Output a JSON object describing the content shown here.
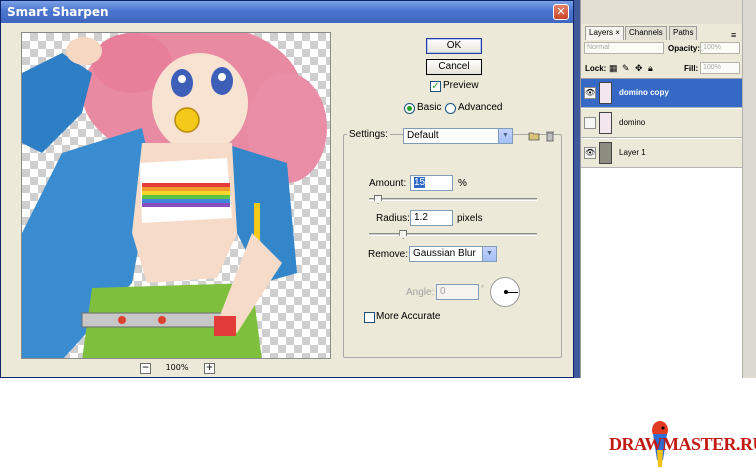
{
  "dialog": {
    "title": "Smart Sharpen",
    "close_glyph": "✕",
    "ok_label": "OK",
    "cancel_label": "Cancel",
    "preview_label": "Preview",
    "preview_checked": true,
    "mode_basic": "Basic",
    "mode_advanced": "Advanced",
    "mode_selected": "Basic",
    "settings_label": "Settings:",
    "settings_value": "Default",
    "amount_label": "Amount:",
    "amount_value": "15",
    "amount_unit": "%",
    "radius_label": "Radius:",
    "radius_value": "1.2",
    "radius_unit": "pixels",
    "remove_label": "Remove:",
    "remove_value": "Gaussian Blur",
    "angle_label": "Angle:",
    "angle_value": "0",
    "angle_unit": "°",
    "more_accurate_label": "More Accurate",
    "more_accurate_checked": false,
    "zoom_minus": "−",
    "zoom_plus": "+",
    "zoom_value": "100%",
    "amount_fraction": 0.03,
    "radius_fraction": 0.18
  },
  "layers_panel": {
    "tabs": [
      "Layers ×",
      "Channels",
      "Paths"
    ],
    "blend_mode": "Normal",
    "opacity_label": "Opacity:",
    "opacity_value": "100%",
    "lock_label": "Lock:",
    "fill_label": "Fill:",
    "fill_value": "100%",
    "layers": [
      {
        "name": "domino copy",
        "selected": true,
        "visible": true
      },
      {
        "name": "domino",
        "selected": false,
        "visible": false
      },
      {
        "name": "Layer 1",
        "selected": false,
        "visible": true
      }
    ]
  },
  "logo": {
    "text": "DRAWMASTER.RU",
    "colors": {
      "text": "#c21b14",
      "parrot_red": "#e23b24",
      "parrot_blue": "#2a6fd3",
      "parrot_yellow": "#f1c21b"
    }
  },
  "colors": {
    "dialog_bg": "#ece9d8",
    "titlebar": "#4b76d0",
    "selected_layer": "#3669c6"
  }
}
